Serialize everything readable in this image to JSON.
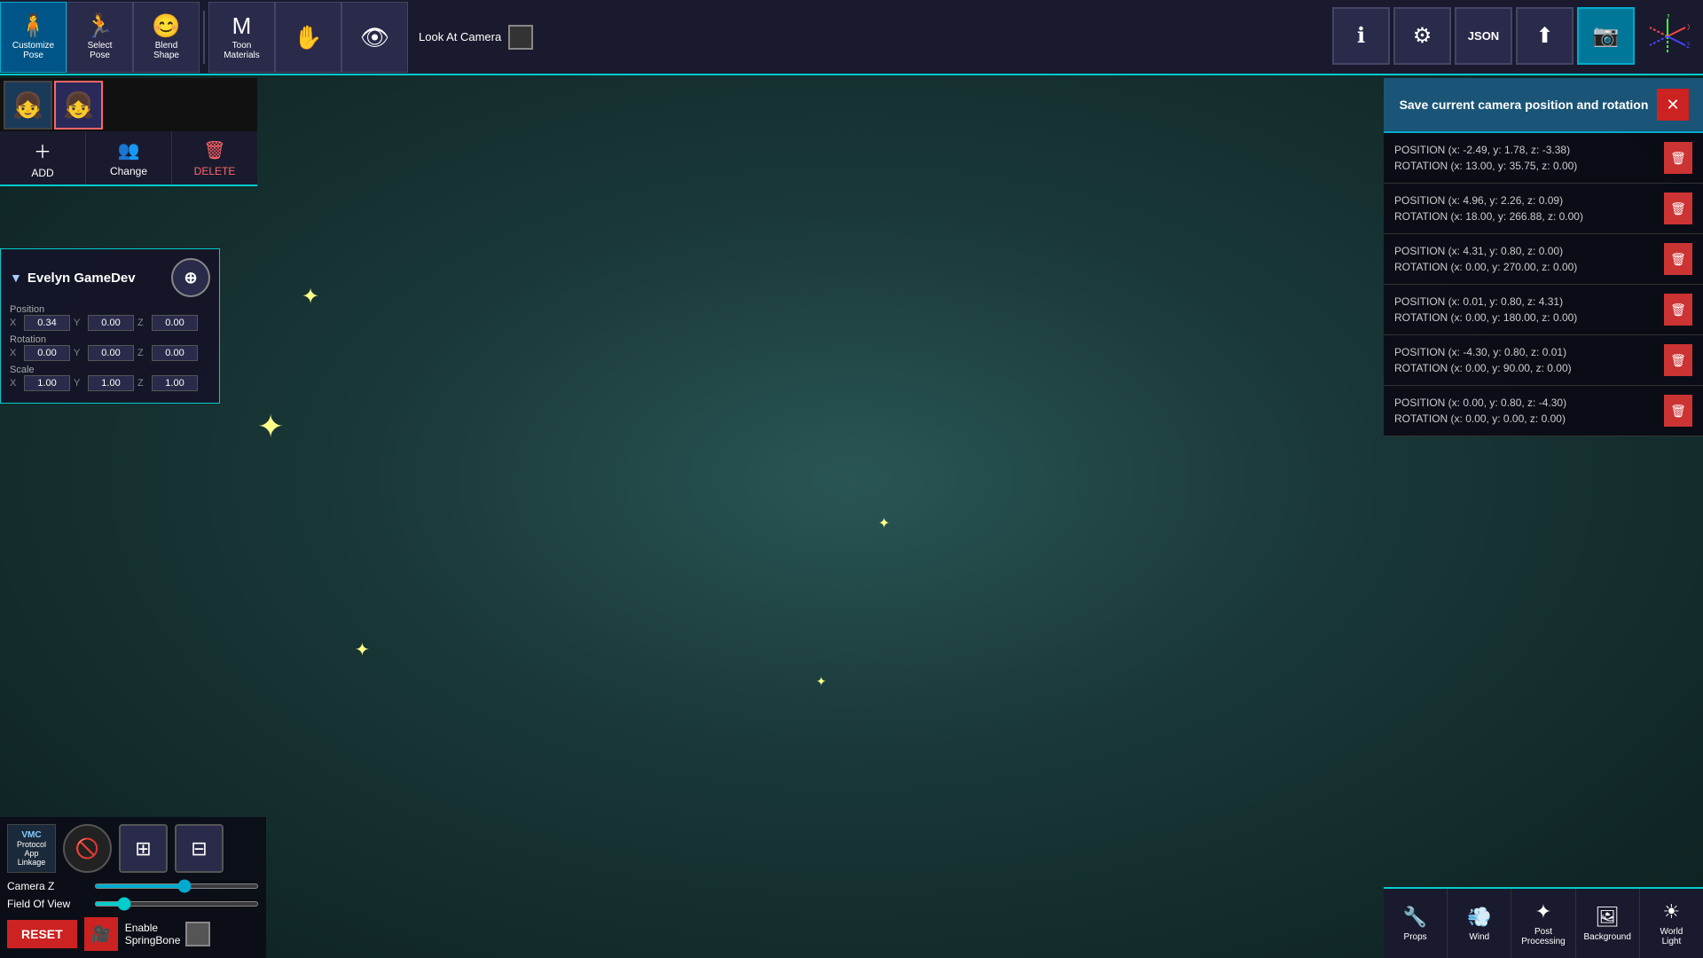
{
  "toolbar": {
    "customize_pose": "Customize\nPose",
    "select_pose": "Select\nPose",
    "blend_shape": "Blend\nShape",
    "toon_materials": "Toon\nMaterials",
    "look_at_camera": "Look At\nCamera",
    "add_label": "ADD",
    "change_label": "Change",
    "delete_label": "DELETE"
  },
  "character": {
    "name": "Evelyn GameDev",
    "position": {
      "x": "0.34",
      "y": "0.00",
      "z": "0.00"
    },
    "rotation": {
      "x": "0.00",
      "y": "0.00",
      "z": "0.00"
    },
    "scale": {
      "x": "1.00",
      "y": "1.00",
      "z": "1.00"
    }
  },
  "controls": {
    "camera_z_label": "Camera Z",
    "field_of_view_label": "Field Of View",
    "reset_label": "RESET",
    "enable_springbone_label": "Enable\nSpringBone"
  },
  "camera_panel": {
    "title": "Save current camera position and rotation",
    "positions": [
      {
        "pos": "POSITION (x: -2.49, y: 1.78, z: -3.38)",
        "rot": "ROTATION (x: 13.00, y: 35.75, z: 0.00)"
      },
      {
        "pos": "POSITION (x: 4.96, y: 2.26, z: 0.09)",
        "rot": "ROTATION (x: 18.00, y: 266.88, z: 0.00)"
      },
      {
        "pos": "POSITION (x: 4.31, y: 0.80, z: 0.00)",
        "rot": "ROTATION (x: 0.00, y: 270.00, z: 0.00)"
      },
      {
        "pos": "POSITION (x: 0.01, y: 0.80, z: 4.31)",
        "rot": "ROTATION (x: 0.00, y: 180.00, z: 0.00)"
      },
      {
        "pos": "POSITION (x: -4.30, y: 0.80, z: 0.01)",
        "rot": "ROTATION (x: 0.00, y: 90.00, z: 0.00)"
      },
      {
        "pos": "POSITION (x: 0.00, y: 0.80, z: -4.30)",
        "rot": "ROTATION (x: 0.00, y: 0.00, z: 0.00)"
      }
    ]
  },
  "bottom_tools": {
    "props": "Props",
    "wind": "Wind",
    "post_processing": "Post\nProcessing",
    "background": "Background",
    "world_light": "World\nLight"
  },
  "icons": {
    "info": "ℹ",
    "settings": "⚙",
    "json": "JSON",
    "upload": "⬆",
    "camera": "📷",
    "add": "+",
    "change": "👥",
    "delete": "🗑",
    "person_move": "⊕",
    "close": "✕",
    "trash": "🗑",
    "props": "🔧",
    "wind": "💨",
    "post_processing": "✦",
    "background": "🖼",
    "world_light": "☀",
    "app_linkage": "VMC",
    "eye_off": "🚫",
    "expand": "⊞",
    "grid": "⊟",
    "reset_icon": "⟲"
  }
}
